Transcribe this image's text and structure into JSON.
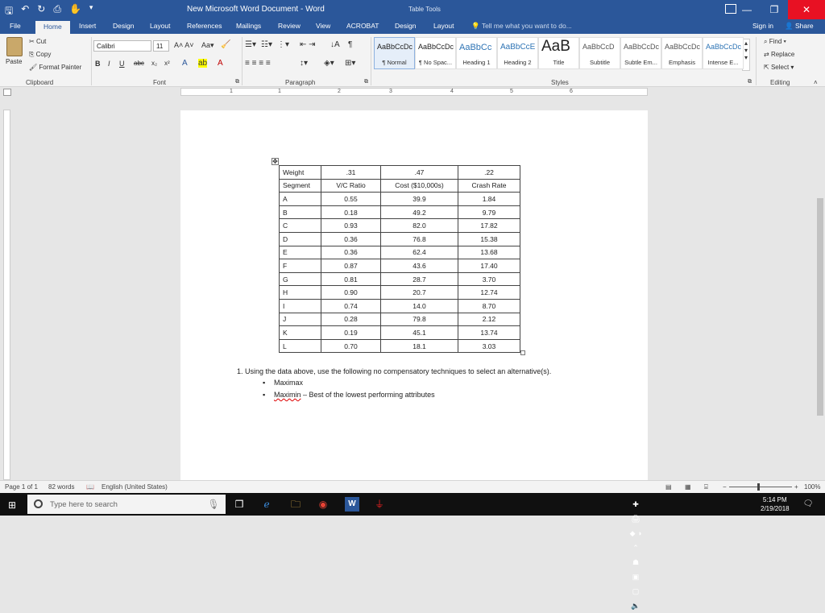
{
  "window": {
    "title": "New Microsoft Word Document - Word",
    "context_tab": "Table Tools",
    "icons": [
      "save-icon",
      "undo-icon",
      "redo-icon",
      "print-preview-icon",
      "touch-mode-icon"
    ]
  },
  "tabs": {
    "file": "File",
    "home": "Home",
    "insert": "Insert",
    "design": "Design",
    "layout": "Layout",
    "references": "References",
    "mailings": "Mailings",
    "review": "Review",
    "view": "View",
    "acrobat": "ACROBAT",
    "table_design": "Design",
    "table_layout": "Layout",
    "tell_me": "Tell me what you want to do...",
    "sign_in": "Sign in",
    "share": "Share"
  },
  "ribbon": {
    "clipboard": {
      "label": "Clipboard",
      "paste": "Paste",
      "cut": "Cut",
      "copy": "Copy",
      "format_painter": "Format Painter"
    },
    "font": {
      "label": "Font",
      "name": "Calibri",
      "size": "11"
    },
    "paragraph": {
      "label": "Paragraph"
    },
    "styles": {
      "label": "Styles",
      "items": [
        {
          "sample": "AaBbCcDc",
          "name": "¶ Normal"
        },
        {
          "sample": "AaBbCcDc",
          "name": "¶ No Spac..."
        },
        {
          "sample": "AaBbCc",
          "name": "Heading 1"
        },
        {
          "sample": "AaBbCcE",
          "name": "Heading 2"
        },
        {
          "sample": "AaB",
          "name": "Title"
        },
        {
          "sample": "AaBbCcD",
          "name": "Subtitle"
        },
        {
          "sample": "AaBbCcDc",
          "name": "Subtle Em..."
        },
        {
          "sample": "AaBbCcDc",
          "name": "Emphasis"
        },
        {
          "sample": "AaBbCcDc",
          "name": "Intense E..."
        }
      ]
    },
    "editing": {
      "label": "Editing",
      "find": "Find",
      "replace": "Replace",
      "select": "Select"
    }
  },
  "ruler": {
    "numbers": [
      "1",
      "1",
      "2",
      "3",
      "4",
      "5",
      "6"
    ]
  },
  "document": {
    "table": {
      "rows": [
        [
          "Weight",
          ".31",
          ".47",
          ".22"
        ],
        [
          "Segment",
          "V/C Ratio",
          "Cost ($10,000s)",
          "Crash Rate"
        ],
        [
          "A",
          "0.55",
          "39.9",
          "1.84"
        ],
        [
          "B",
          "0.18",
          "49.2",
          "9.79"
        ],
        [
          "C",
          "0.93",
          "82.0",
          "17.82"
        ],
        [
          "D",
          "0.36",
          "76.8",
          "15.38"
        ],
        [
          "E",
          "0.36",
          "62.4",
          "13.68"
        ],
        [
          "F",
          "0.87",
          "43.6",
          "17.40"
        ],
        [
          "G",
          "0.81",
          "28.7",
          "3.70"
        ],
        [
          "H",
          "0.90",
          "20.7",
          "12.74"
        ],
        [
          "I",
          "0.74",
          "14.0",
          "8.70"
        ],
        [
          "J",
          "0.28",
          "79.8",
          "2.12"
        ],
        [
          "K",
          "0.19",
          "45.1",
          "13.74"
        ],
        [
          "L",
          "0.70",
          "18.1",
          "3.03"
        ]
      ]
    },
    "question": "1.   Using the data above, use the following no compensatory techniques to select an alternative(s).",
    "bullets": [
      {
        "text": "Maximax"
      },
      {
        "prefix": "Maximin",
        "text": " – Best of the lowest performing attributes"
      }
    ]
  },
  "status": {
    "page": "Page 1 of 1",
    "words": "82 words",
    "language": "English (United States)",
    "zoom": "100%"
  },
  "taskbar": {
    "search_placeholder": "Type here to search",
    "time": "5:14 PM",
    "date": "2/19/2018"
  }
}
